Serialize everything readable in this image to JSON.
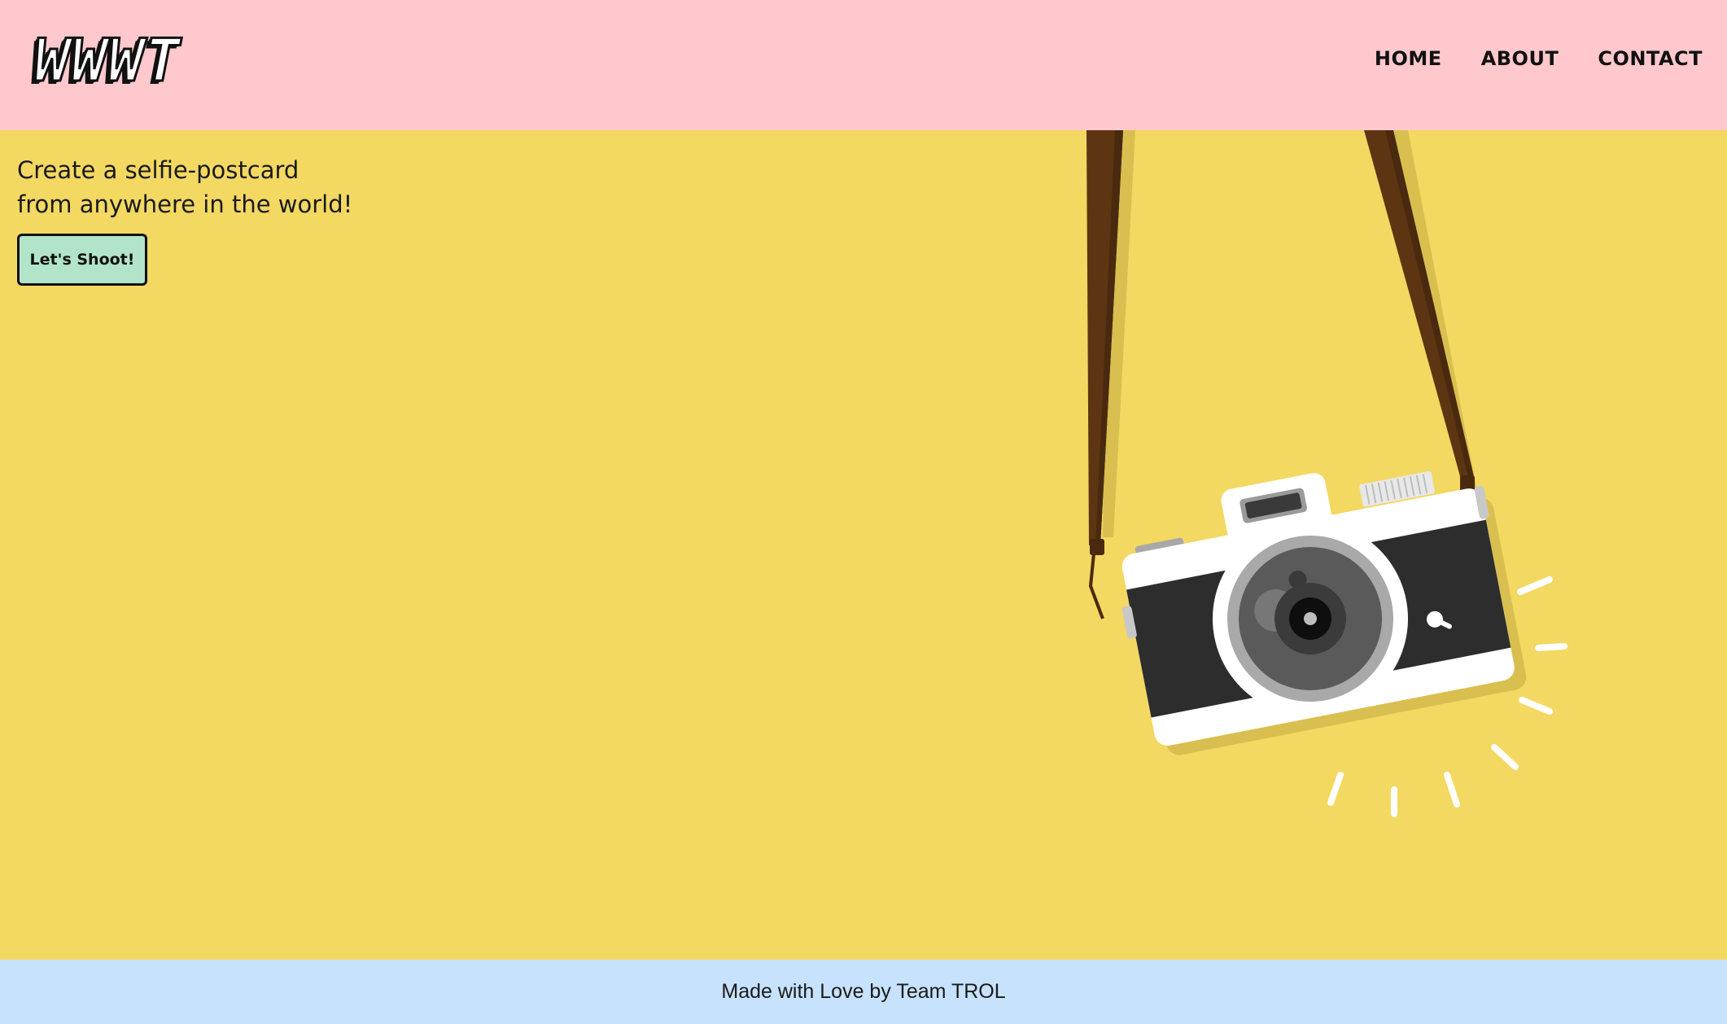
{
  "header": {
    "logo_text": "WWWT",
    "nav": [
      {
        "label": "HOME"
      },
      {
        "label": "ABOUT"
      },
      {
        "label": "CONTACT"
      }
    ]
  },
  "hero": {
    "tagline_line1": "Create a selfie-postcard",
    "tagline_line2": "from anywhere in the world!",
    "cta_label": "Let's Shoot!",
    "illustration": "camera-icon"
  },
  "footer": {
    "text": "Made with Love by Team TROL"
  },
  "colors": {
    "header_bg": "#ffc8cd",
    "main_bg": "#f3d862",
    "footer_bg": "#c6e2fd",
    "cta_bg": "#b2e4c9"
  }
}
